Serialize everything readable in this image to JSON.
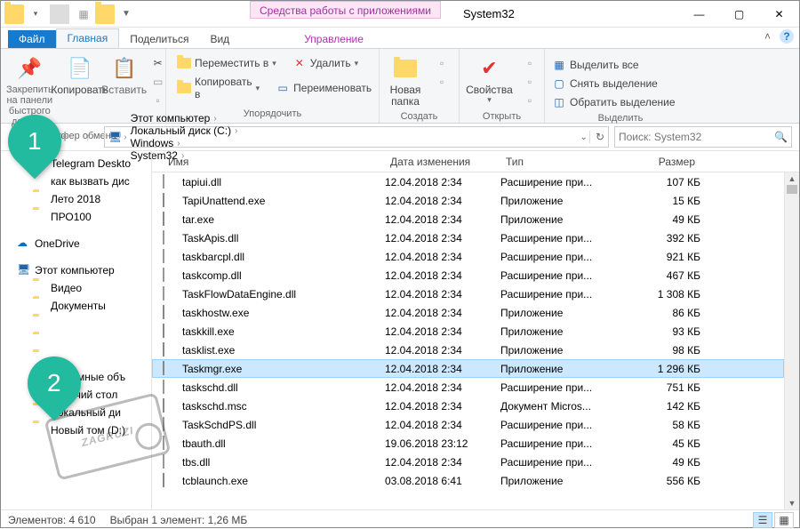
{
  "window": {
    "contextTab": "Средства работы с приложениями",
    "title": "System32"
  },
  "tabs": {
    "file": "Файл",
    "home": "Главная",
    "share": "Поделиться",
    "view": "Вид",
    "manage": "Управление"
  },
  "ribbon": {
    "pin": "Закрепить на панели быстрого доступа",
    "copy": "Копировать",
    "paste": "Вставить",
    "clipboardGroup": "Буфер обмена",
    "moveTo": "Переместить в",
    "copyTo": "Копировать в",
    "delete": "Удалить",
    "rename": "Переименовать",
    "organizeGroup": "Упорядочить",
    "newFolder": "Новая папка",
    "newGroup": "Создать",
    "properties": "Свойства",
    "openGroup": "Открыть",
    "selectAll": "Выделить все",
    "selectNone": "Снять выделение",
    "invertSelection": "Обратить выделение",
    "selectGroup": "Выделить"
  },
  "breadcrumbs": [
    "Этот компьютер",
    "Локальный диск (C:)",
    "Windows",
    "System32"
  ],
  "search": {
    "placeholder": "Поиск: System32"
  },
  "columns": {
    "name": "Имя",
    "date": "Дата изменения",
    "type": "Тип",
    "size": "Размер"
  },
  "tree": {
    "quick": [
      {
        "label": "Telegram Deskto"
      },
      {
        "label": "как вызвать дис"
      },
      {
        "label": "Лето 2018"
      },
      {
        "label": "ПРО100"
      }
    ],
    "onedrive": "OneDrive",
    "thispc": "Этот компьютер",
    "pcItems": [
      {
        "label": "Видео"
      },
      {
        "label": "Документы"
      },
      {
        "label": ""
      },
      {
        "label": ""
      },
      {
        "label": ""
      },
      {
        "label": "Объемные объ"
      },
      {
        "label": "Рабочий стол"
      },
      {
        "label": "Локальный ди"
      },
      {
        "label": "Новый том (D:)"
      }
    ]
  },
  "files": [
    {
      "name": "tapiui.dll",
      "date": "12.04.2018 2:34",
      "type": "Расширение при...",
      "size": "107 КБ",
      "kind": "dll"
    },
    {
      "name": "TapiUnattend.exe",
      "date": "12.04.2018 2:34",
      "type": "Приложение",
      "size": "15 КБ",
      "kind": "exe"
    },
    {
      "name": "tar.exe",
      "date": "12.04.2018 2:34",
      "type": "Приложение",
      "size": "49 КБ",
      "kind": "exe"
    },
    {
      "name": "TaskApis.dll",
      "date": "12.04.2018 2:34",
      "type": "Расширение при...",
      "size": "392 КБ",
      "kind": "dll"
    },
    {
      "name": "taskbarcpl.dll",
      "date": "12.04.2018 2:34",
      "type": "Расширение при...",
      "size": "921 КБ",
      "kind": "dll"
    },
    {
      "name": "taskcomp.dll",
      "date": "12.04.2018 2:34",
      "type": "Расширение при...",
      "size": "467 КБ",
      "kind": "dll"
    },
    {
      "name": "TaskFlowDataEngine.dll",
      "date": "12.04.2018 2:34",
      "type": "Расширение при...",
      "size": "1 308 КБ",
      "kind": "dll"
    },
    {
      "name": "taskhostw.exe",
      "date": "12.04.2018 2:34",
      "type": "Приложение",
      "size": "86 КБ",
      "kind": "exe"
    },
    {
      "name": "taskkill.exe",
      "date": "12.04.2018 2:34",
      "type": "Приложение",
      "size": "93 КБ",
      "kind": "exe"
    },
    {
      "name": "tasklist.exe",
      "date": "12.04.2018 2:34",
      "type": "Приложение",
      "size": "98 КБ",
      "kind": "exe"
    },
    {
      "name": "Taskmgr.exe",
      "date": "12.04.2018 2:34",
      "type": "Приложение",
      "size": "1 296 КБ",
      "kind": "exe",
      "selected": true
    },
    {
      "name": "taskschd.dll",
      "date": "12.04.2018 2:34",
      "type": "Расширение при...",
      "size": "751 КБ",
      "kind": "dll"
    },
    {
      "name": "taskschd.msc",
      "date": "12.04.2018 2:34",
      "type": "Документ Micros...",
      "size": "142 КБ",
      "kind": "msc"
    },
    {
      "name": "TaskSchdPS.dll",
      "date": "12.04.2018 2:34",
      "type": "Расширение при...",
      "size": "58 КБ",
      "kind": "dll"
    },
    {
      "name": "tbauth.dll",
      "date": "19.06.2018 23:12",
      "type": "Расширение при...",
      "size": "45 КБ",
      "kind": "dll"
    },
    {
      "name": "tbs.dll",
      "date": "12.04.2018 2:34",
      "type": "Расширение при...",
      "size": "49 КБ",
      "kind": "dll"
    },
    {
      "name": "tcblaunch.exe",
      "date": "03.08.2018 6:41",
      "type": "Приложение",
      "size": "556 КБ",
      "kind": "exe"
    }
  ],
  "status": {
    "count": "Элементов: 4 610",
    "selection": "Выбран 1 элемент: 1,26 МБ"
  },
  "badges": {
    "one": "1",
    "two": "2"
  },
  "stamp": "ZAGRUZI"
}
